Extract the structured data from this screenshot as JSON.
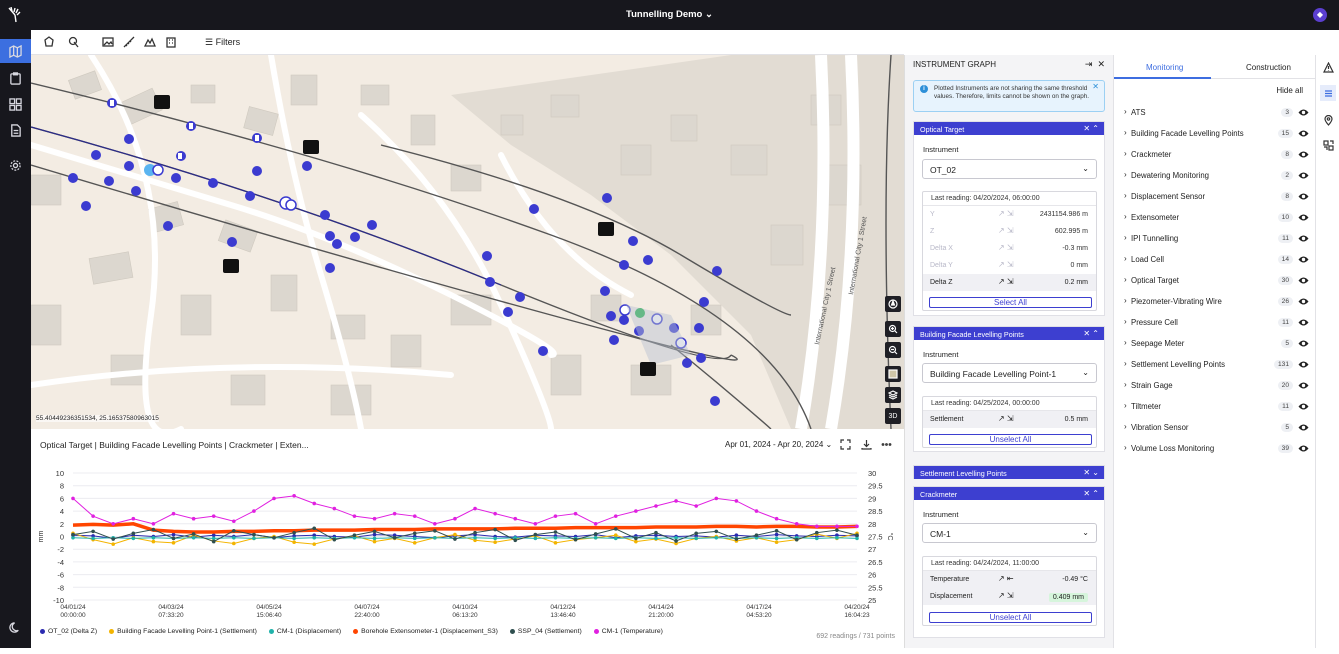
{
  "app": {
    "title": "Tunnelling Demo",
    "avatar": "◆"
  },
  "toolbar": {
    "filters_label": "Filters"
  },
  "map": {
    "coordinates": "55.40449236351534, 25.16537580963015",
    "street_labels": [
      "International City 1 Street",
      "International City 1 Street"
    ],
    "ctrl_3d": "3D"
  },
  "graph": {
    "title": "Optical Target | Building Facade Levelling Points | Crackmeter | Exten...",
    "date_range": "Apr 01, 2024 - Apr 20, 2024",
    "count": "692 readings / 731 points",
    "legend": [
      {
        "label": "OT_02 (Delta Z)",
        "color": "#2b2bb0"
      },
      {
        "label": "Building Facade Levelling Point-1 (Settlement)",
        "color": "#f3b400"
      },
      {
        "label": "CM-1 (Displacement)",
        "color": "#20b2aa"
      },
      {
        "label": "Borehole Extensometer-1 (Displacement_S3)",
        "color": "#ff4500"
      },
      {
        "label": "SSP_04 (Settlement)",
        "color": "#2f4f4f"
      },
      {
        "label": "CM-1 (Temperature)",
        "color": "#e020e0"
      }
    ]
  },
  "chart_data": {
    "type": "line",
    "x_labels": [
      "04/01/24\n00:00:00",
      "04/03/24\n07:33:20",
      "04/05/24\n15:06:40",
      "04/07/24\n22:40:00",
      "04/10/24\n06:13:20",
      "04/12/24\n13:46:40",
      "04/14/24\n21:20:00",
      "04/17/24\n04:53:20",
      "04/20/24\n16:04:23"
    ],
    "left_axis": {
      "label": "mm",
      "ticks": [
        10,
        8,
        6,
        4,
        2,
        0,
        -2,
        -4,
        -6,
        -8,
        -10
      ],
      "range": [
        -10,
        10
      ]
    },
    "right_axis": {
      "label": "°C",
      "ticks": [
        30,
        29.5,
        29,
        28.5,
        28,
        27.5,
        27,
        26.5,
        26,
        25.5,
        25
      ],
      "range": [
        25,
        30
      ]
    },
    "series": [
      {
        "name": "OT_02 (Delta Z)",
        "axis": "left",
        "color": "#2b2bb0",
        "values": [
          0.2,
          0.1,
          -0.3,
          0.2,
          0,
          0.3,
          -0.1,
          0.2,
          0,
          0.3,
          -0.2,
          0.1,
          0.2,
          0,
          -0.1,
          0.3,
          0.2,
          0,
          -0.2,
          0.1,
          0.3,
          0,
          -0.1,
          0.2,
          0.1,
          0,
          0.3,
          -0.2,
          0.1,
          0.2,
          0,
          0.1,
          -0.1,
          0.2,
          0,
          0.3,
          0.1,
          0,
          0.2,
          0.1
        ]
      },
      {
        "name": "Building Facade Levelling Point-1 (Settlement)",
        "axis": "left",
        "color": "#f3b400",
        "values": [
          0.5,
          -0.5,
          -1.2,
          -0.2,
          -0.8,
          -1.0,
          0.2,
          -0.7,
          -1.1,
          -0.3,
          0,
          -0.9,
          -1.2,
          -0.4,
          0.1,
          -0.8,
          -0.3,
          -1.0,
          -0.2,
          0.3,
          -0.6,
          -0.9,
          -0.4,
          0.1,
          -1.0,
          -0.5,
          -0.2,
          0.2,
          -0.8,
          -0.4,
          -1.1,
          -0.3,
          0,
          -0.7,
          -0.2,
          -0.9,
          -0.5,
          0.4,
          -0.3,
          0.5
        ]
      },
      {
        "name": "CM-1 (Displacement)",
        "axis": "left",
        "color": "#20b2aa",
        "values": [
          -0.2,
          -0.3,
          -0.2,
          -0.3,
          -0.2,
          -0.3,
          -0.2,
          -0.3,
          -0.2,
          -0.3,
          -0.2,
          -0.3,
          -0.2,
          -0.3,
          -0.2,
          -0.3,
          -0.2,
          -0.3,
          -0.2,
          -0.3,
          -0.2,
          -0.3,
          -0.2,
          -0.3,
          -0.2,
          -0.3,
          -0.2,
          -0.3,
          -0.2,
          -0.3,
          -0.2,
          -0.3,
          -0.2,
          -0.3,
          -0.2,
          -0.3,
          -0.2,
          -0.3,
          -0.2,
          -0.3
        ]
      },
      {
        "name": "Borehole Extensometer-1 (Displacement_S3)",
        "axis": "left",
        "color": "#ff4500",
        "values": [
          1.8,
          1.9,
          1.8,
          2.0,
          1.0,
          0.8,
          0.7,
          0.7,
          0.8,
          0.8,
          0.9,
          0.9,
          1.0,
          1.0,
          1.0,
          1.1,
          1.1,
          1.1,
          1.2,
          1.2,
          1.2,
          1.2,
          1.3,
          1.3,
          1.3,
          1.4,
          1.4,
          1.4,
          1.4,
          1.5,
          1.5,
          1.5,
          1.6,
          1.6,
          1.5,
          1.6,
          1.6,
          1.5,
          1.5,
          1.6
        ]
      },
      {
        "name": "SSP_04 (Settlement)",
        "axis": "left",
        "color": "#2f4f4f",
        "values": [
          0.3,
          0.8,
          -0.4,
          0.5,
          1.1,
          -0.3,
          0.4,
          -0.8,
          0.9,
          0.3,
          -0.2,
          0.6,
          1.3,
          -0.5,
          0.2,
          0.8,
          -0.2,
          0.5,
          0.9,
          -0.4,
          0.6,
          1.1,
          -0.6,
          0.3,
          0.7,
          -0.5,
          0.4,
          1.2,
          -0.3,
          0.6,
          -0.7,
          0.5,
          0.8,
          -0.4,
          0.2,
          0.9,
          -0.5,
          0.6,
          1.0,
          0.2
        ]
      },
      {
        "name": "CM-1 (Temperature)",
        "axis": "right",
        "color": "#e020e0",
        "values": [
          29.0,
          28.3,
          28.0,
          28.2,
          28.0,
          28.4,
          28.2,
          28.3,
          28.1,
          28.5,
          29.0,
          29.1,
          28.8,
          28.6,
          28.3,
          28.2,
          28.4,
          28.3,
          28.0,
          28.2,
          28.6,
          28.4,
          28.2,
          28.0,
          28.3,
          28.4,
          28.0,
          28.3,
          28.5,
          28.7,
          28.9,
          28.7,
          29.0,
          28.9,
          28.5,
          28.2,
          28.0,
          27.9,
          27.9,
          27.9
        ]
      }
    ]
  },
  "instrument_panel": {
    "title": "INSTRUMENT GRAPH",
    "info": "Plotted Instruments are not sharing the same threshold values. Therefore, limits cannot be shown on the graph.",
    "sections": [
      {
        "title": "Optical Target",
        "field_label": "Instrument",
        "selected": "OT_02",
        "last_reading": "Last reading: 04/20/2024, 06:00:00",
        "rows": [
          {
            "name": "Y",
            "value": "2431154.986 m"
          },
          {
            "name": "Z",
            "value": "602.995 m"
          },
          {
            "name": "Delta X",
            "value": "-0.3 mm"
          },
          {
            "name": "Delta Y",
            "value": "0 mm"
          },
          {
            "name": "Delta Z",
            "value": "0.2 mm"
          }
        ],
        "button": "Select All"
      },
      {
        "title": "Building Facade Levelling Points",
        "field_label": "Instrument",
        "selected": "Building Facade Levelling Point-1",
        "last_reading": "Last reading: 04/25/2024, 00:00:00",
        "rows": [
          {
            "name": "Settlement",
            "value": "0.5 mm"
          }
        ],
        "button": "Unselect All"
      },
      {
        "title": "Settlement Levelling Points"
      },
      {
        "title": "Crackmeter",
        "field_label": "Instrument",
        "selected": "CM-1",
        "last_reading": "Last reading: 04/24/2024, 11:00:00",
        "rows": [
          {
            "name": "Temperature",
            "value": "-0.49 °C"
          },
          {
            "name": "Displacement",
            "value": "0.409 mm"
          }
        ],
        "button": "Unselect All"
      }
    ]
  },
  "monitoring_panel": {
    "tabs": [
      "Monitoring",
      "Construction"
    ],
    "hide_all": "Hide all",
    "items": [
      {
        "name": "ATS",
        "count": "3"
      },
      {
        "name": "Building Facade Levelling Points",
        "count": "15"
      },
      {
        "name": "Crackmeter",
        "count": "8"
      },
      {
        "name": "Dewatering Monitoring",
        "count": "2"
      },
      {
        "name": "Displacement Sensor",
        "count": "8"
      },
      {
        "name": "Extensometer",
        "count": "10"
      },
      {
        "name": "IPI Tunnelling",
        "count": "11"
      },
      {
        "name": "Load Cell",
        "count": "14"
      },
      {
        "name": "Optical Target",
        "count": "30"
      },
      {
        "name": "Piezometer-Vibrating Wire",
        "count": "26"
      },
      {
        "name": "Pressure Cell",
        "count": "11"
      },
      {
        "name": "Seepage Meter",
        "count": "5"
      },
      {
        "name": "Settlement Levelling Points",
        "count": "131"
      },
      {
        "name": "Strain Gage",
        "count": "20"
      },
      {
        "name": "Tiltmeter",
        "count": "11"
      },
      {
        "name": "Vibration Sensor",
        "count": "5"
      },
      {
        "name": "Volume Loss Monitoring",
        "count": "39"
      }
    ]
  }
}
